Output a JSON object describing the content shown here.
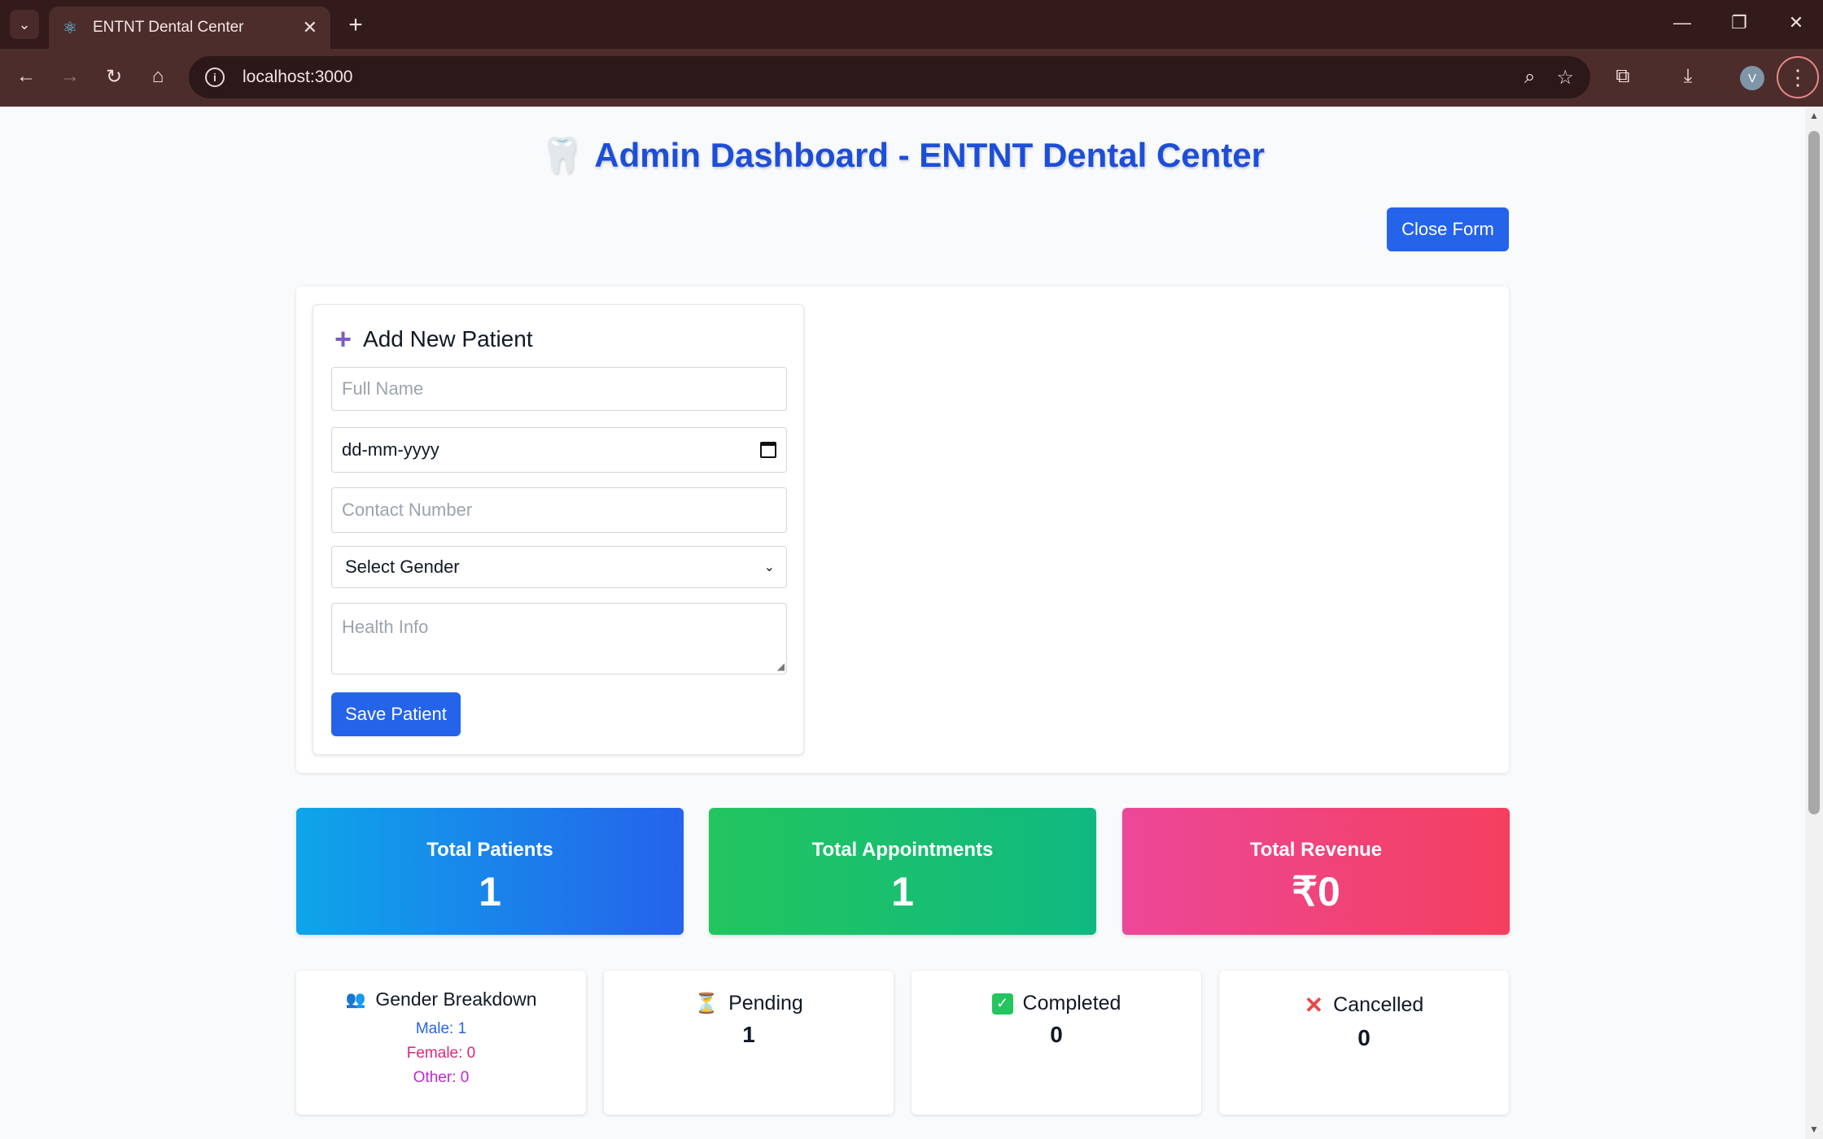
{
  "browser": {
    "tab_title": "ENTNT Dental Center",
    "url": "localhost:3000",
    "profile_initial": "V"
  },
  "page": {
    "title": "Admin Dashboard - ENTNT Dental Center",
    "close_form_label": "Close Form"
  },
  "form": {
    "title": "Add New Patient",
    "full_name_placeholder": "Full Name",
    "dob_placeholder": "dd-mm-yyyy",
    "contact_placeholder": "Contact Number",
    "gender_selected": "Select Gender",
    "health_placeholder": "Health Info",
    "save_label": "Save Patient"
  },
  "stats": {
    "total_patients": {
      "label": "Total Patients",
      "value": "1"
    },
    "total_appointments": {
      "label": "Total Appointments",
      "value": "1"
    },
    "total_revenue": {
      "label": "Total Revenue",
      "value": "₹0"
    }
  },
  "gender_breakdown": {
    "title": "Gender Breakdown",
    "male": "Male: 1",
    "female": "Female: 0",
    "other": "Other: 0"
  },
  "status": {
    "pending": {
      "label": "Pending",
      "value": "1"
    },
    "completed": {
      "label": "Completed",
      "value": "0"
    },
    "cancelled": {
      "label": "Cancelled",
      "value": "0"
    }
  },
  "colors": {
    "accent": "#2563eb",
    "title": "#1d4ed8",
    "male": "#2563eb",
    "female": "#db2777",
    "other": "#c026d3"
  }
}
